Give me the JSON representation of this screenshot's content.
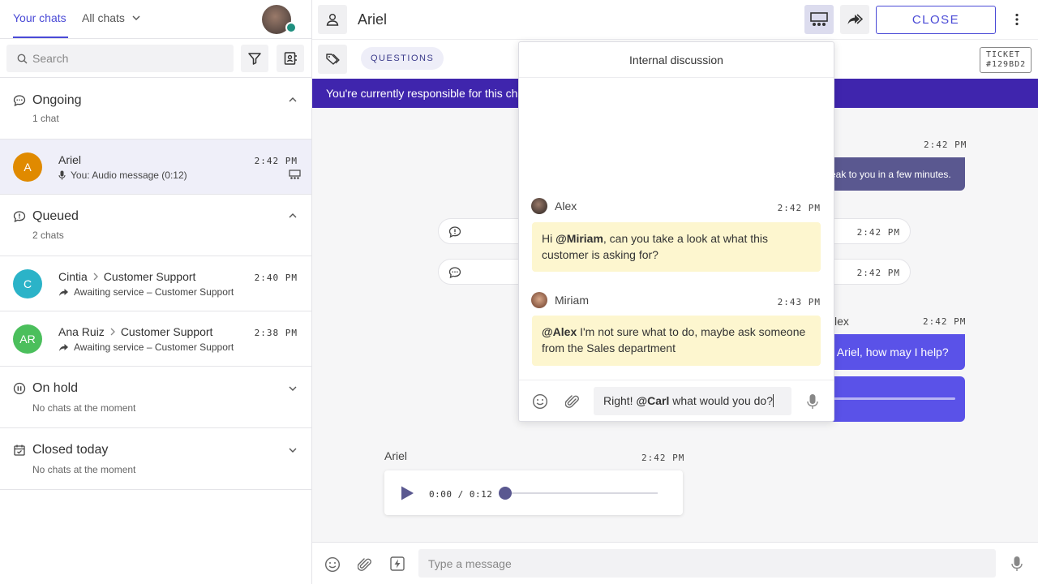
{
  "sidebar": {
    "tabs": [
      "Your chats",
      "All chats"
    ],
    "search_placeholder": "Search",
    "sections": {
      "ongoing": {
        "title": "Ongoing",
        "count": "1 chat"
      },
      "queued": {
        "title": "Queued",
        "count": "2 chats"
      },
      "on_hold": {
        "title": "On hold",
        "empty": "No chats at the moment"
      },
      "closed": {
        "title": "Closed today",
        "empty": "No chats at the moment"
      }
    },
    "chats": [
      {
        "initial": "A",
        "name": "Ariel",
        "preview": "You: Audio message (0:12)",
        "time": "2:42 PM",
        "color": "#e08a00"
      },
      {
        "initial": "C",
        "name": "Cintia",
        "group": "Customer Support",
        "preview": "Awaiting service – Customer Support",
        "time": "2:40 PM",
        "color": "#2bb3c8"
      },
      {
        "initial": "AR",
        "name": "Ana Ruiz",
        "group": "Customer Support",
        "preview": "Awaiting service – Customer Support",
        "time": "2:38 PM",
        "color": "#4bbf5c"
      }
    ]
  },
  "header": {
    "title": "Ariel",
    "close_label": "CLOSE",
    "tag_label": "QUESTIONS",
    "ticket_label": "TICKET",
    "ticket_id": "#129BD2"
  },
  "banner": {
    "text": "You're currently responsible for this ch"
  },
  "conversation": {
    "msg1_time": "2:42 PM",
    "msg1_text": "eak to you in a few minutes.",
    "sys1_time": "2:42 PM",
    "sys2_time": "2:42 PM",
    "msg2_author": "lex",
    "msg2_time": "2:42 PM",
    "msg2_text": "o Ariel, how may I help?",
    "audio_author": "Ariel",
    "audio_time": "2:42 PM",
    "audio_progress": "0:00 / 0:12"
  },
  "composer": {
    "placeholder": "Type a message"
  },
  "internal": {
    "title": "Internal discussion",
    "messages": [
      {
        "author": "Alex",
        "time": "2:42 PM",
        "mention": "@Miriam",
        "text": ", can you take a look at what this customer is asking for?",
        "prefix": "Hi "
      },
      {
        "author": "Miriam",
        "time": "2:43 PM",
        "mention": "@Alex",
        "text": " I'm not sure what to do, maybe ask someone from the Sales department",
        "prefix": ""
      }
    ],
    "draft_prefix": "Right! ",
    "draft_mention": "@Carl",
    "draft_suffix": " what would you do?"
  }
}
